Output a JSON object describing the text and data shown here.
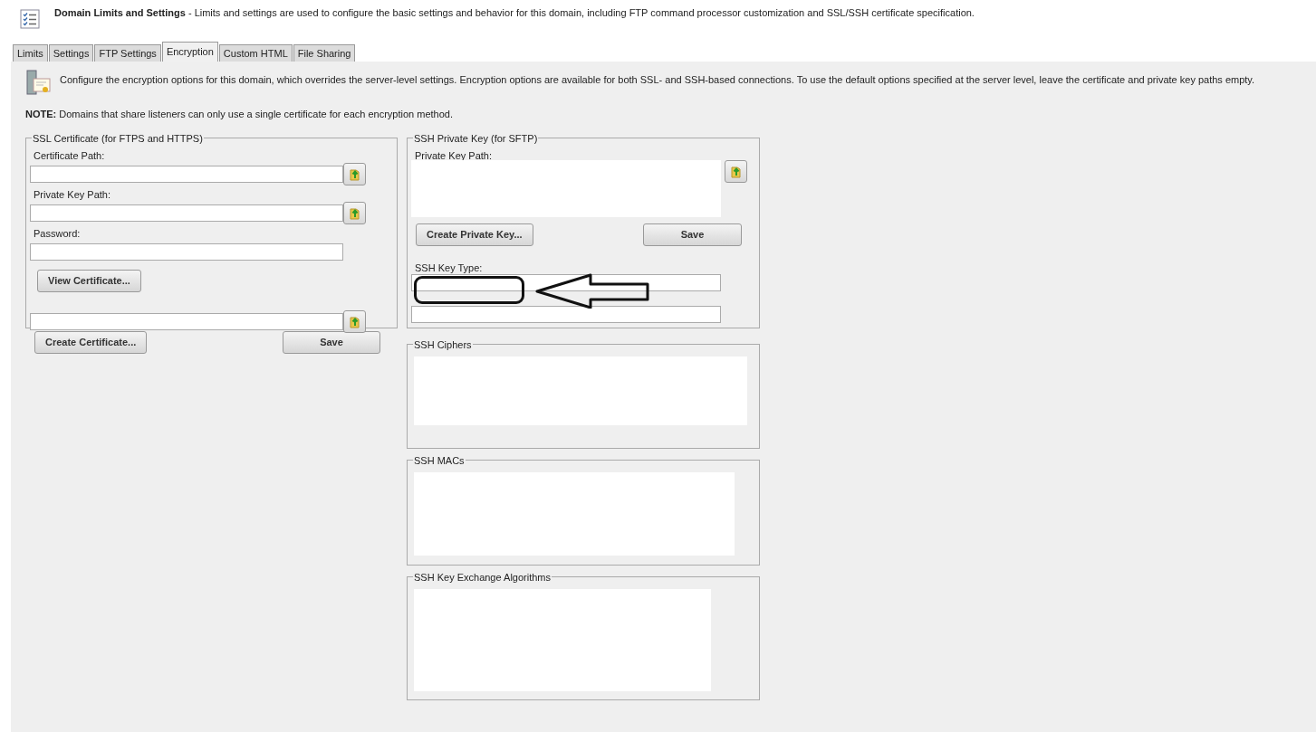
{
  "header": {
    "title": "Domain Limits and Settings",
    "description": " - Limits and settings are used to configure the basic settings and behavior for this domain, including FTP command processor customization and SSL/SSH certificate specification."
  },
  "tabs": [
    {
      "label": "Limits",
      "selected": false
    },
    {
      "label": "Settings",
      "selected": false
    },
    {
      "label": "FTP Settings",
      "selected": false
    },
    {
      "label": "Encryption",
      "selected": true
    },
    {
      "label": "Custom HTML",
      "selected": false
    },
    {
      "label": "File Sharing",
      "selected": false
    }
  ],
  "intro": "Configure the encryption options for this domain, which overrides the server-level settings. Encryption options are available for both SSL- and SSH-based connections. To use the default options specified at the server level, leave the certificate and private key paths empty.",
  "note": "**NOTE:** Domains that share listeners can only use a single certificate for each encryption method.",
  "ssl": {
    "legend": "SSL Certificate (for FTPS and HTTPS)",
    "fields": [
      {
        "label": "Certificate Path:",
        "browse": true
      },
      {
        "label": "Private Key Path:",
        "browse": true
      },
      {
        "label": "Password:",
        "browse": false
      }
    ],
    "view_button": "View Certificate...",
    "buttons": [
      "Create Certificate...",
      "Save"
    ]
  },
  "ssh": {
    "legend": "SSH Private Key (for SFTP)",
    "key_path_label": "Private Key Path:",
    "buttons": [
      "Create Private Key...",
      "Save"
    ],
    "key_type_label": "SSH Key Type:"
  },
  "lists": [
    {
      "legend": "SSH Ciphers"
    },
    {
      "legend": "SSH MACs"
    },
    {
      "legend": "SSH Key Exchange Algorithms"
    }
  ]
}
